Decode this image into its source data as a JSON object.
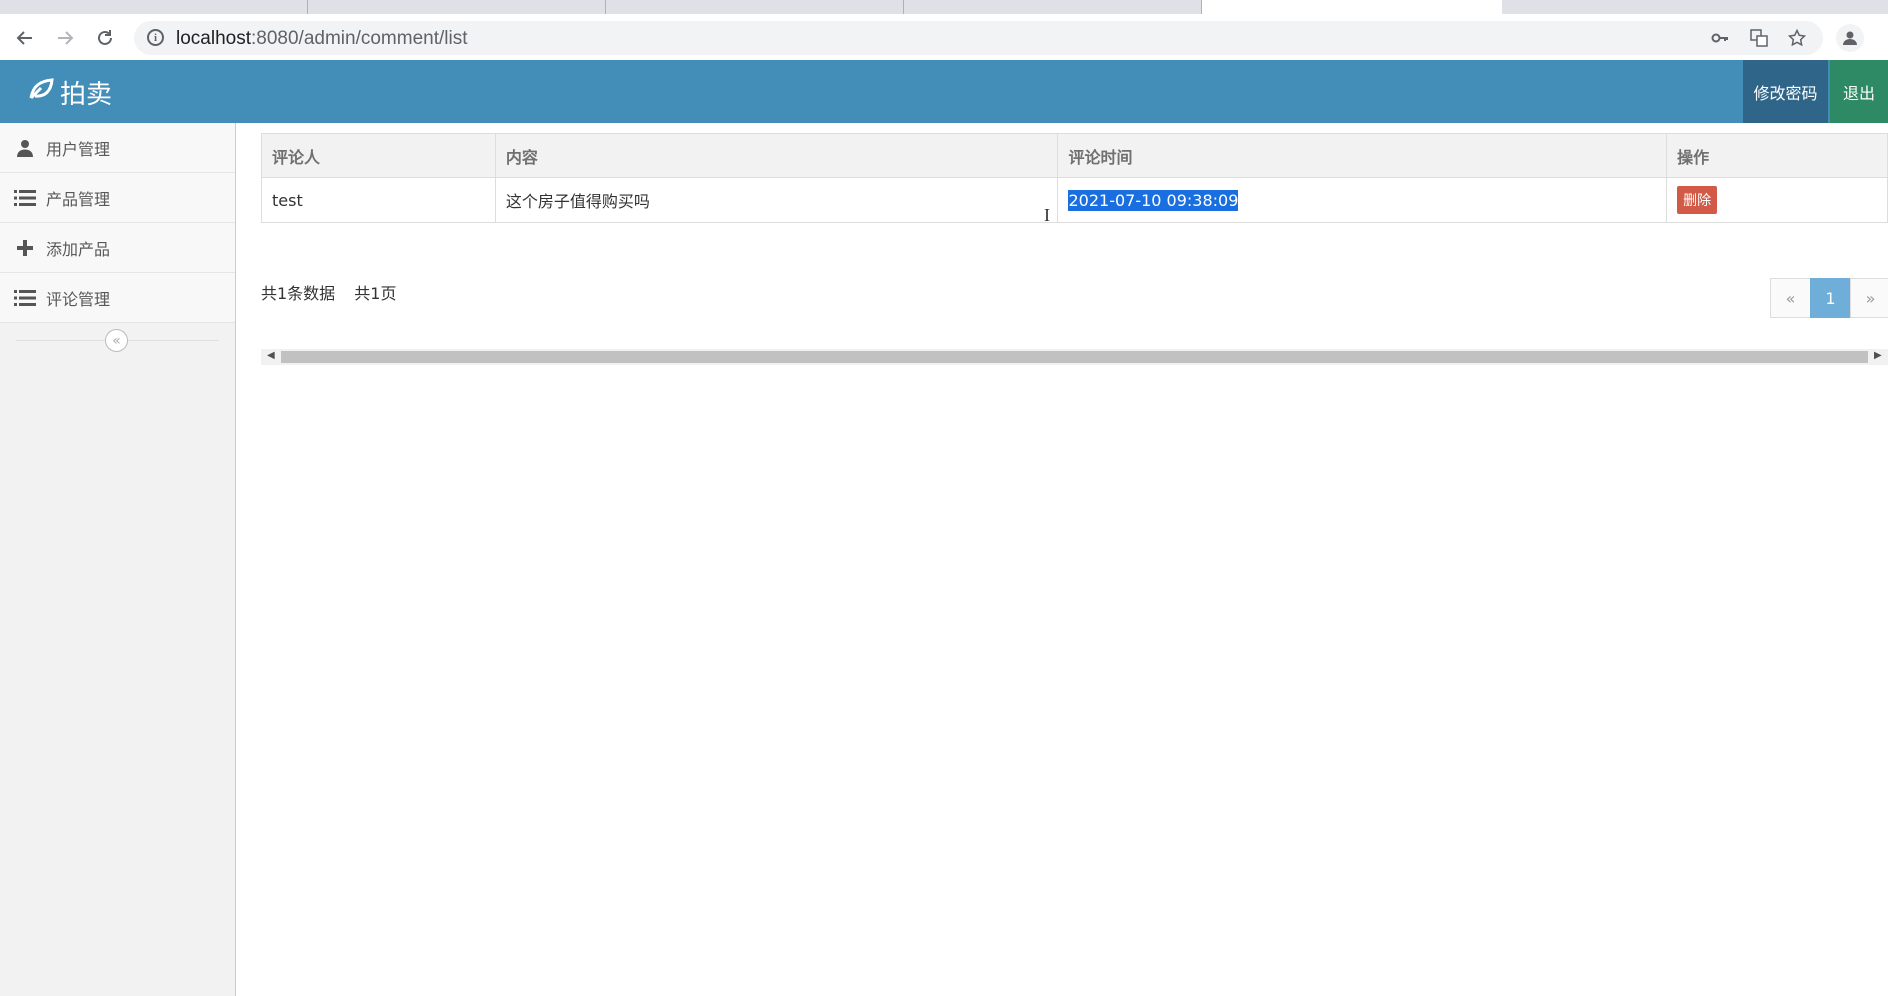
{
  "browser": {
    "url_host": "localhost",
    "url_rest": ":8080/admin/comment/list"
  },
  "header": {
    "brand": "拍卖",
    "change_password": "修改密码",
    "logout": "退出"
  },
  "sidebar": {
    "items": [
      {
        "label": "用户管理",
        "icon": "user-icon"
      },
      {
        "label": "产品管理",
        "icon": "list-icon"
      },
      {
        "label": "添加产品",
        "icon": "plus-icon"
      },
      {
        "label": "评论管理",
        "icon": "list-icon"
      }
    ]
  },
  "table": {
    "columns": [
      "评论人",
      "内容",
      "评论时间",
      "操作"
    ],
    "rows": [
      {
        "author": "test",
        "content": "这个房子值得购买吗",
        "time": "2021-07-10 09:38:09",
        "action": "删除"
      }
    ]
  },
  "pagination": {
    "total_records": "共1条数据",
    "total_pages": "共1页",
    "prev": "«",
    "current": "1",
    "next": "»"
  }
}
